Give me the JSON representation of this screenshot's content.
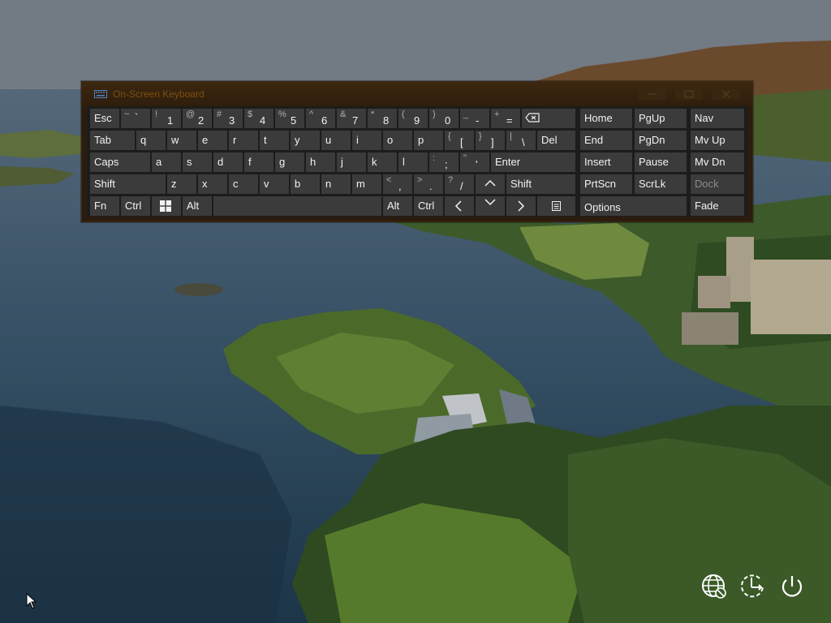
{
  "osk": {
    "title": "On-Screen Keyboard",
    "rows": {
      "r1": {
        "esc": "Esc",
        "tilde": {
          "sub": "~",
          "main": "`"
        },
        "d1": {
          "sub": "!",
          "main": "1"
        },
        "d2": {
          "sub": "@",
          "main": "2"
        },
        "d3": {
          "sub": "#",
          "main": "3"
        },
        "d4": {
          "sub": "$",
          "main": "4"
        },
        "d5": {
          "sub": "%",
          "main": "5"
        },
        "d6": {
          "sub": "^",
          "main": "6"
        },
        "d7": {
          "sub": "&",
          "main": "7"
        },
        "d8": {
          "sub": "*",
          "main": "8"
        },
        "d9": {
          "sub": "(",
          "main": "9"
        },
        "d0": {
          "sub": ")",
          "main": "0"
        },
        "minus": {
          "sub": "_",
          "main": "-"
        },
        "equals": {
          "sub": "+",
          "main": "="
        },
        "home": "Home",
        "pgup": "PgUp",
        "nav": "Nav"
      },
      "r2": {
        "tab": "Tab",
        "q": "q",
        "w": "w",
        "e": "e",
        "r": "r",
        "t": "t",
        "y": "y",
        "u": "u",
        "i": "i",
        "o": "o",
        "p": "p",
        "lbracket": {
          "sub": "{",
          "main": "["
        },
        "rbracket": {
          "sub": "}",
          "main": "]"
        },
        "backslash": {
          "sub": "|",
          "main": "\\"
        },
        "del": "Del",
        "end": "End",
        "pgdn": "PgDn",
        "mvup": "Mv Up"
      },
      "r3": {
        "caps": "Caps",
        "a": "a",
        "s": "s",
        "d": "d",
        "f": "f",
        "g": "g",
        "h": "h",
        "j": "j",
        "k": "k",
        "l": "l",
        "semicolon": {
          "sub": ":",
          "main": ";"
        },
        "quote": {
          "sub": "\"",
          "main": "'"
        },
        "enter": "Enter",
        "insert": "Insert",
        "pause": "Pause",
        "mvdn": "Mv Dn"
      },
      "r4": {
        "lshift": "Shift",
        "z": "z",
        "x": "x",
        "c": "c",
        "v": "v",
        "b": "b",
        "n": "n",
        "m": "m",
        "comma": {
          "sub": "<",
          "main": ","
        },
        "period": {
          "sub": ">",
          "main": "."
        },
        "slash": {
          "sub": "?",
          "main": "/"
        },
        "rshift": "Shift",
        "prtscn": "PrtScn",
        "scrlk": "ScrLk",
        "dock": "Dock"
      },
      "r5": {
        "fn": "Fn",
        "lctrl": "Ctrl",
        "lalt": "Alt",
        "ralt": "Alt",
        "rctrl": "Ctrl",
        "options": "Options",
        "fade": "Fade"
      }
    }
  },
  "colors": {
    "accent": "#7d4f0f",
    "key_bg": "#3b3b3b",
    "key_text": "#f2f2f2"
  },
  "system_icons": [
    "globe-accessibility-icon",
    "ease-of-access-icon",
    "power-icon"
  ]
}
